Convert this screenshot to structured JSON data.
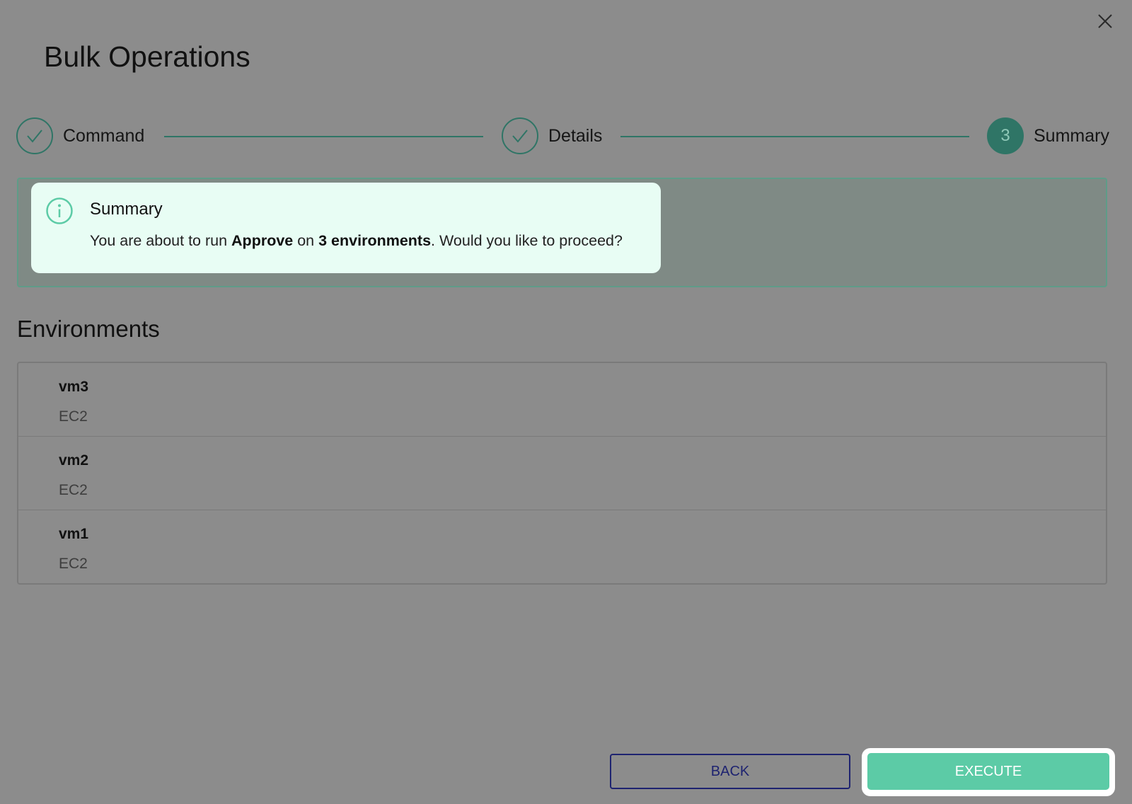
{
  "dialog": {
    "title": "Bulk Operations",
    "close_icon": "close-icon"
  },
  "stepper": {
    "color": "#2f7566",
    "steps": [
      {
        "label": "Command",
        "state": "completed",
        "icon": "check-icon"
      },
      {
        "label": "Details",
        "state": "completed",
        "icon": "check-icon"
      },
      {
        "label": "Summary",
        "state": "active",
        "number": "3"
      }
    ]
  },
  "summary": {
    "icon": "info-icon",
    "title": "Summary",
    "text_prefix": "You are about to run ",
    "command": "Approve",
    "text_mid": " on ",
    "target": "3 environments",
    "text_suffix": ". Would you like to proceed?"
  },
  "environments": {
    "heading": "Environments",
    "items": [
      {
        "name": "vm3",
        "type": "EC2"
      },
      {
        "name": "vm2",
        "type": "EC2"
      },
      {
        "name": "vm1",
        "type": "EC2"
      }
    ]
  },
  "actions": {
    "back_label": "BACK",
    "execute_label": "EXECUTE",
    "execute_color": "#5ccba6",
    "back_color": "#1e2370"
  }
}
